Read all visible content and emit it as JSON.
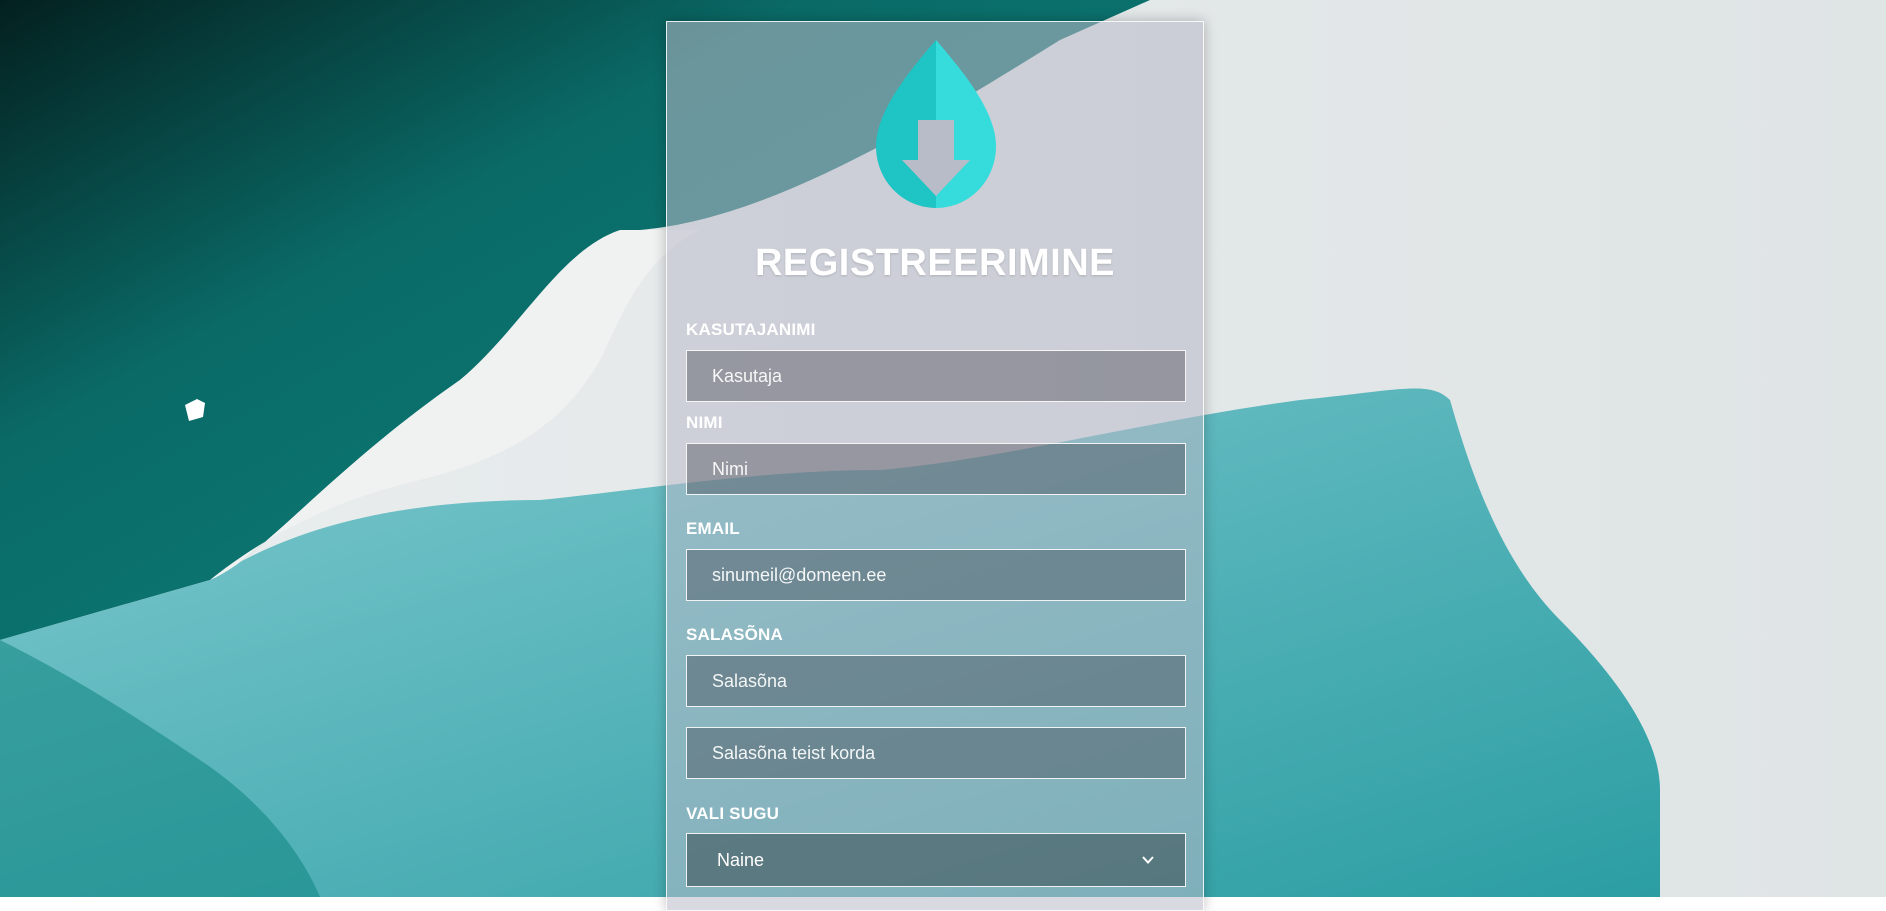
{
  "colors": {
    "accent": "#2fd2d2",
    "accent_dark": "#1fbdbd",
    "title": "#ffffff"
  },
  "form": {
    "title": "REGISTREERIMINE",
    "logo_icon": "download-drop-icon",
    "username": {
      "label": "KASUTAJANIMI",
      "placeholder": "Kasutaja",
      "value": ""
    },
    "name": {
      "label": "NIMI",
      "placeholder": "Nimi",
      "value": ""
    },
    "email": {
      "label": "EMAIL",
      "placeholder": "sinumeil@domeen.ee",
      "value": ""
    },
    "password": {
      "label": "SALASÕNA",
      "placeholder": "Salasõna",
      "value": ""
    },
    "password_repeat": {
      "placeholder": "Salasõna teist korda",
      "value": ""
    },
    "gender": {
      "label": "VALI SUGU",
      "selected": "Naine",
      "icon": "chevron-down-icon"
    }
  }
}
